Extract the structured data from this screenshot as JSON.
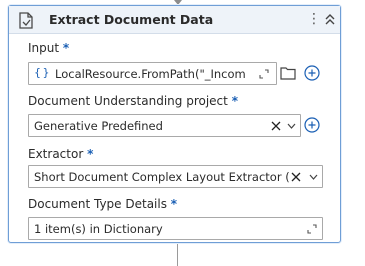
{
  "activity": {
    "title": "Extract Document Data",
    "header_icon": "document-extract-icon",
    "kebab_label": "⋮",
    "collapse_icon": "double-chevron-up-icon"
  },
  "fields": {
    "input": {
      "label": "Input",
      "required_mark": "*",
      "prefix_glyph": "{ }",
      "value": "LocalResource.FromPath(\"_Incom",
      "expand_icon": "expand-editor-icon",
      "folder_icon": "folder-icon",
      "add_icon": "plus-circle-icon"
    },
    "du_project": {
      "label": "Document Understanding project",
      "required_mark": "*",
      "value": "Generative Predefined",
      "clear_icon": "close-icon",
      "dropdown_icon": "chevron-down-icon",
      "add_icon": "plus-circle-icon"
    },
    "extractor": {
      "label": "Extractor",
      "required_mark": "*",
      "value": "Short Document Complex Layout Extractor (pi",
      "clear_icon": "close-icon",
      "dropdown_icon": "chevron-down-icon"
    },
    "doc_type_details": {
      "label": "Document Type Details",
      "required_mark": "*",
      "value": "1 item(s) in Dictionary",
      "expand_icon": "expand-editor-icon"
    }
  },
  "colors": {
    "accent": "#1a5fb4",
    "card_border": "#6f9ed6",
    "header_bg": "#eef3f9"
  }
}
